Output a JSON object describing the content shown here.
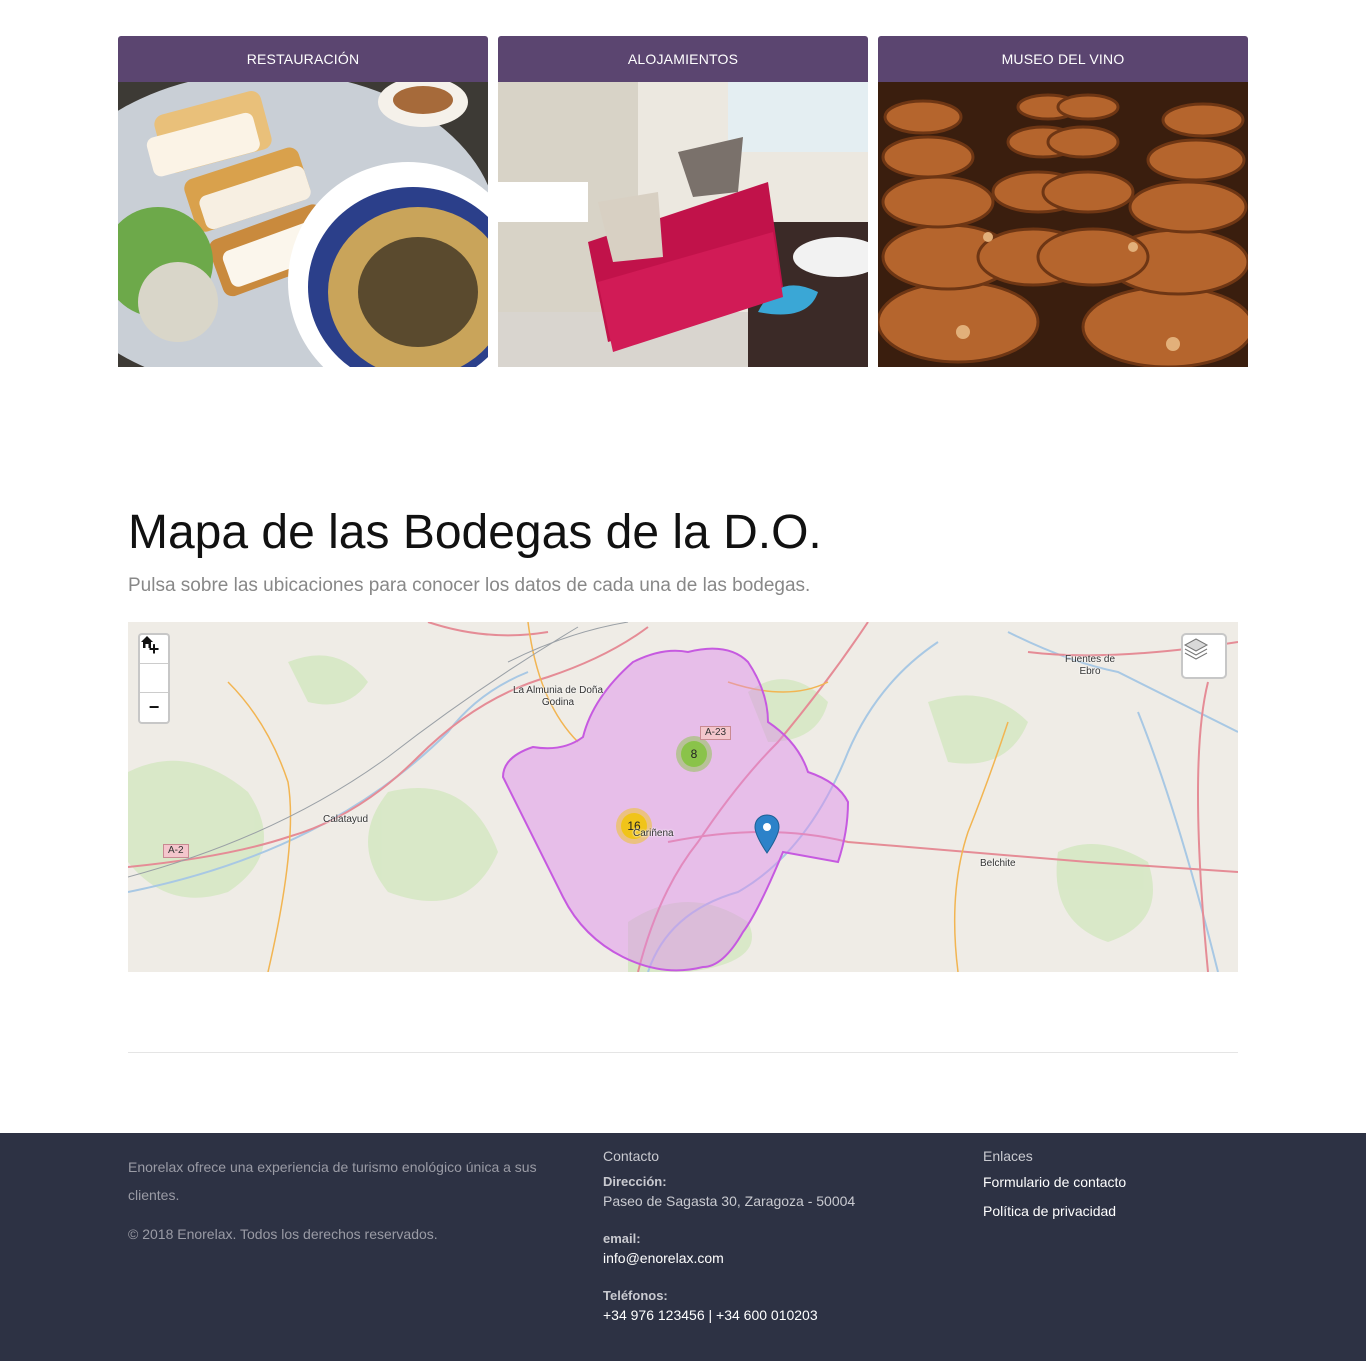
{
  "cards": [
    {
      "title": "RESTAURACIÓN"
    },
    {
      "title": "ALOJAMIENTOS"
    },
    {
      "title": "MUSEO DEL VINO"
    }
  ],
  "map_section": {
    "title": "Mapa de las Bodegas de la D.O.",
    "subtitle": "Pulsa sobre las ubicaciones para conocer los datos de cada una de las bodegas.",
    "zoom_in": "+",
    "zoom_out": "−",
    "clusters": [
      {
        "count": "8",
        "color": "#8ac34a"
      },
      {
        "count": "16",
        "color": "#f0c419"
      }
    ],
    "places": [
      "La Almunia de Doña Godina",
      "Calatayud",
      "Cariñena",
      "Fuentes de Ebro",
      "Belchite"
    ],
    "roads": [
      "A-23",
      "A-2"
    ],
    "region_color": "#dd88ee",
    "marker_color": "#2c82c9"
  },
  "footer": {
    "about": "Enorelax ofrece una experiencia de turismo enológico única a sus clientes.",
    "copyright": "©  2018 Enorelax. Todos los derechos reservados.",
    "contact": {
      "heading": "Contacto",
      "address_label": "Dirección:",
      "address": "Paseo de Sagasta 30, Zaragoza - 50004",
      "email_label": "email:",
      "email": "info@enorelax.com",
      "phone_label": "Teléfonos:",
      "phones": "+34 976 123456 | +34 600 010203"
    },
    "links": {
      "heading": "Enlaces",
      "items": [
        "Formulario de contacto",
        "Política de privacidad"
      ]
    },
    "background": "#2d3244"
  },
  "colors": {
    "card_header": "#5b4570"
  }
}
